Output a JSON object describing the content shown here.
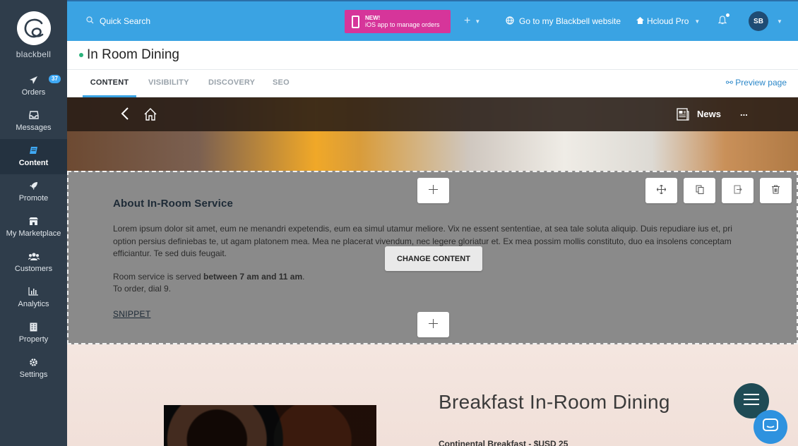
{
  "brand": {
    "name": "blackbell"
  },
  "sidebar": {
    "items": [
      {
        "label": "Orders",
        "icon": "paper-plane-icon",
        "badge": "37"
      },
      {
        "label": "Messages",
        "icon": "inbox-icon"
      },
      {
        "label": "Content",
        "icon": "book-icon",
        "active": true
      },
      {
        "label": "Promote",
        "icon": "rocket-icon"
      },
      {
        "label": "My Marketplace",
        "icon": "store-icon"
      },
      {
        "label": "Customers",
        "icon": "users-icon"
      },
      {
        "label": "Analytics",
        "icon": "bar-chart-icon"
      },
      {
        "label": "Property",
        "icon": "building-icon"
      },
      {
        "label": "Settings",
        "icon": "gear-icon"
      }
    ]
  },
  "topbar": {
    "search_label": "Quick Search",
    "promo_new": "NEW!",
    "promo_text": "iOS app to manage orders",
    "add_label": "+",
    "website_link": "Go to my Blackbell website",
    "property_name": "Hcloud Pro",
    "avatar_initials": "SB"
  },
  "page": {
    "title": "In Room Dining",
    "tabs": [
      "CONTENT",
      "VISIBILITY",
      "DISCOVERY",
      "SEO"
    ],
    "active_tab": "CONTENT",
    "preview_label": "Preview page"
  },
  "hero": {
    "nav_label": "News",
    "more_label": "..."
  },
  "section": {
    "title": "About In-Room Service",
    "paragraph": "Lorem ipsum dolor sit amet, eum ne menandri expetendis, eum ea simul utamur meliore. Vix ne essent sententiae, at sea tale soluta aliquip. Duis repudiare ius et, pri option persius definiebas te, ut agam platonem mea. Mea ne placerat vivendum, nec legere gloriatur et. Ex mea possim mollis constituto, duo ea insolens conceptam efficiantur. Te sed duis feugait.",
    "hours_prefix": "Room service is served ",
    "hours_bold": "between 7 am and 11 am",
    "hours_suffix": ".",
    "order_line": "To order, dial 9.",
    "snippet_label": "SNIPPET",
    "change_label": "CHANGE CONTENT"
  },
  "breakfast": {
    "title": "Breakfast In-Room Dining",
    "subtitle": "Continental Breakfast - $USD 25"
  },
  "colors": {
    "sidebar": "#2f3d4b",
    "topbar": "#3aa3e3",
    "promo": "#d6359a",
    "accent": "#3fa9f5"
  }
}
